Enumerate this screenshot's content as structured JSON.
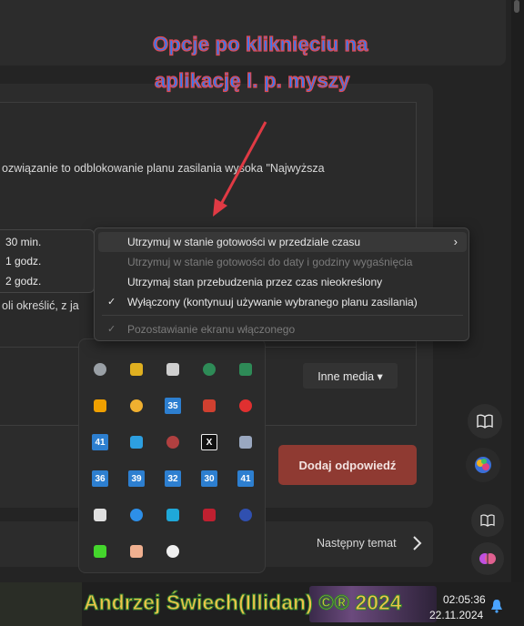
{
  "annotation": {
    "line1": "Opcje po kliknięciu na",
    "line2": "aplikację l. p. myszy"
  },
  "page": {
    "body_line1": "ozwiązanie to odblokowanie planu zasilania wysoka \"Najwyższa",
    "body_line2": "oli określić, z ja",
    "media_button": "Inne media ▾",
    "reply_button": "Dodaj odpowiedź",
    "next_topic": "Następny temat"
  },
  "context_menu": {
    "items": [
      {
        "label": "Utrzymuj w stanie gotowości w przedziale czasu",
        "has_submenu": true,
        "highlighted": true,
        "disabled": false,
        "checked": false
      },
      {
        "label": "Utrzymuj w stanie gotowości do daty i godziny wygaśnięcia",
        "has_submenu": false,
        "highlighted": false,
        "disabled": true,
        "checked": false
      },
      {
        "label": "Utrzymaj stan przebudzenia przez czas nieokreślony",
        "has_submenu": false,
        "highlighted": false,
        "disabled": false,
        "checked": false
      },
      {
        "label": "Wyłączony (kontynuuj używanie wybranego planu zasilania)",
        "has_submenu": false,
        "highlighted": false,
        "disabled": false,
        "checked": true
      },
      {
        "label": "Pozostawianie ekranu włączonego",
        "has_submenu": false,
        "highlighted": false,
        "disabled": true,
        "checked": true
      }
    ]
  },
  "submenu": {
    "items": [
      "30 min.",
      "1 godz.",
      "2 godz."
    ]
  },
  "tray": {
    "icons": [
      {
        "name": "coffee-cup-icon",
        "text": "",
        "color": "#9aa0a6"
      },
      {
        "name": "monitor-color-icon",
        "text": "",
        "color": "#e0b020"
      },
      {
        "name": "calculator-icon",
        "text": "",
        "color": "#cfcfcf"
      },
      {
        "name": "network-icon",
        "text": "",
        "color": "#2e8b57"
      },
      {
        "name": "network-icon-2",
        "text": "",
        "color": "#2e8b57"
      },
      {
        "name": "disc-icon",
        "text": "",
        "color": "#f0a000"
      },
      {
        "name": "weather-icon",
        "text": "",
        "color": "#f0b030"
      },
      {
        "name": "calendar-35-icon",
        "text": "35",
        "color": "#2d7fd0"
      },
      {
        "name": "app-grid-icon",
        "text": "",
        "color": "#d04030"
      },
      {
        "name": "pokeball-icon",
        "text": "",
        "color": "#e03030"
      },
      {
        "name": "calendar-41-icon",
        "text": "41",
        "color": "#2d7fd0"
      },
      {
        "name": "storage-icon",
        "text": "",
        "color": "#2d9fe0"
      },
      {
        "name": "battery-icon",
        "text": "",
        "color": "#b04040"
      },
      {
        "name": "x-app-icon",
        "text": "X",
        "color": "#ffffff"
      },
      {
        "name": "user-badge-icon",
        "text": "",
        "color": "#9aa8c0"
      },
      {
        "name": "calendar-36-icon",
        "text": "36",
        "color": "#2d7fd0"
      },
      {
        "name": "calendar-39-icon",
        "text": "39",
        "color": "#2d7fd0"
      },
      {
        "name": "calendar-32-icon",
        "text": "32",
        "color": "#2d7fd0"
      },
      {
        "name": "calendar-30-icon",
        "text": "30",
        "color": "#2d7fd0"
      },
      {
        "name": "calendar-41b-icon",
        "text": "41",
        "color": "#2d7fd0"
      },
      {
        "name": "usb-icon",
        "text": "",
        "color": "#e0e0e0"
      },
      {
        "name": "bluetooth-icon",
        "text": "",
        "color": "#2d8fe8"
      },
      {
        "name": "edge-icon",
        "text": "",
        "color": "#1fa8d8"
      },
      {
        "name": "red-app-icon",
        "text": "",
        "color": "#c02030"
      },
      {
        "name": "quote-app-icon",
        "text": "",
        "color": "#3050b0"
      },
      {
        "name": "razer-icon",
        "text": "",
        "color": "#44d62c"
      },
      {
        "name": "hand-icon",
        "text": "",
        "color": "#f0b090"
      },
      {
        "name": "brightness-icon",
        "text": "",
        "color": "#f0f0f0"
      }
    ]
  },
  "taskbar": {
    "signature": "Andrzej Świech(Illidan) ©® 2024",
    "time": "02:05:36",
    "date": "22.11.2024"
  },
  "colors": {
    "reply_button": "#8f3a32",
    "annotation_fill": "#2e7cf6",
    "annotation_stroke": "#e04a55",
    "signature": "#f0c24a"
  }
}
